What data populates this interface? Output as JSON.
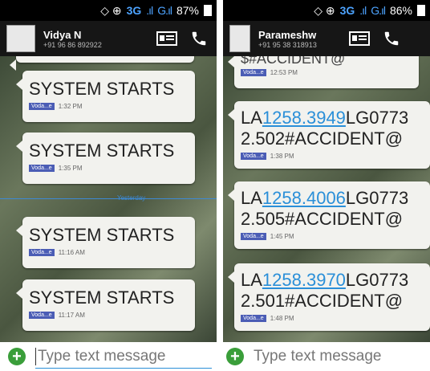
{
  "left": {
    "status": {
      "network": "3G",
      "battery": "87%"
    },
    "contact": {
      "name": "Vidya N",
      "number": "+91 96 86 892922"
    },
    "messages": [
      {
        "text": "SYSTEM STARTS",
        "sim": "Voda...e",
        "time": "1:32 PM"
      },
      {
        "text": "SYSTEM STARTS",
        "sim": "Voda...e",
        "time": "1:35 PM"
      },
      {
        "text": "SYSTEM STARTS",
        "sim": "Voda...e",
        "time": "11:16 AM"
      },
      {
        "text": "SYSTEM STARTS",
        "sim": "Voda...e",
        "time": "11:17 AM"
      }
    ],
    "divider_label": "Yesterday",
    "input_placeholder": "Type text message"
  },
  "right": {
    "status": {
      "network": "3G",
      "battery": "86%"
    },
    "contact": {
      "name": "Parameshw",
      "number": "+91 95 38 318913"
    },
    "messages": [
      {
        "line1": "$#ACCIDENT@",
        "sim": "Voda...e",
        "time": "12:53 PM"
      },
      {
        "prefix": "LA",
        "link": "1258.3949",
        "suffix": "LG0773",
        "line2": "2.502#ACCIDENT@",
        "sim": "Voda...e",
        "time": "1:38 PM"
      },
      {
        "prefix": "LA",
        "link": "1258.4006",
        "suffix": "LG0773",
        "line2": "2.505#ACCIDENT@",
        "sim": "Voda...e",
        "time": "1:45 PM"
      },
      {
        "prefix": "LA",
        "link": "1258.3970",
        "suffix": "LG0773",
        "line2": "2.501#ACCIDENT@",
        "sim": "Voda...e",
        "time": "1:48 PM"
      }
    ],
    "input_placeholder": "Type text message"
  },
  "colors": {
    "link": "#2a8fd8",
    "sim_badge": "#4b5db5",
    "add_button": "#3a9e3a"
  },
  "icons": [
    "contact-card-icon",
    "phone-icon",
    "add-icon",
    "signal-icon",
    "battery-icon"
  ]
}
